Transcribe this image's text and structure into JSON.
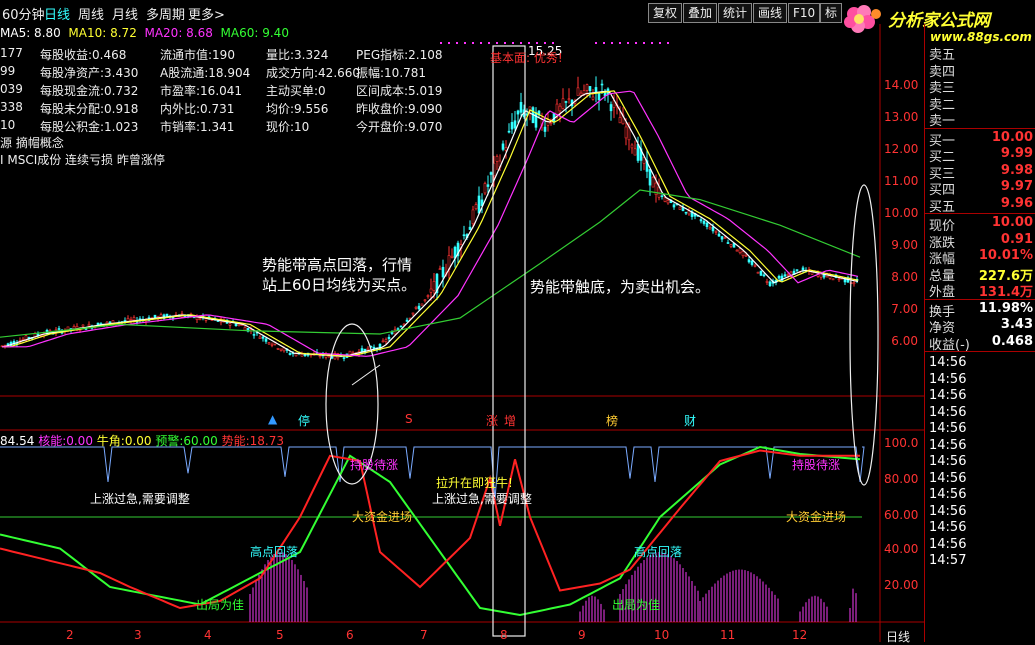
{
  "toolbar": {
    "period_current": "60分钟",
    "day": "日线",
    "week": "周线",
    "month": "月线",
    "multi": "多周期",
    "more": "更多>",
    "buttons": [
      "复权",
      "叠加",
      "统计",
      "画线",
      "F10",
      "标"
    ],
    "logo_text": "分析家公式网",
    "logo_url": "www.88gs.com"
  },
  "info_rows": [
    {
      "c0": "177",
      "c1l": "每股收益:",
      "c1v": "0.468",
      "c2l": "流通市值:",
      "c2v": "190",
      "c3l": "量比:",
      "c3v": "3.324",
      "c4l": "PEG指标:",
      "c4v": "2.108"
    },
    {
      "c0": "99",
      "c1l": "每股净资产:",
      "c1v": "3.430",
      "c2l": "A股流通:",
      "c2v": "18.904",
      "c3l": "成交方向:",
      "c3v": "42.660",
      "c4l": "振幅:",
      "c4v": "10.781"
    },
    {
      "c0": "039",
      "c1l": "每股现金流:",
      "c1v": "0.732",
      "c2l": "市盈率:",
      "c2v": "16.041",
      "c3l": "主动买单:",
      "c3v": "0",
      "c4l": "区间成本:",
      "c4v": "5.019"
    },
    {
      "c0": "338",
      "c1l": "每股未分配:",
      "c1v": "0.918",
      "c2l": "内外比:",
      "c2v": "0.731",
      "c3l": "均价:",
      "c3v": "9.556",
      "c4l": "昨收盘价:",
      "c4v": "9.090"
    },
    {
      "c0": "10",
      "c1l": "每股公积金:",
      "c1v": "1.023",
      "c2l": "市销率:",
      "c2v": "1.341",
      "c3l": "现价:",
      "c3v": "10",
      "c4l": "今开盘价:",
      "c4v": "9.070"
    }
  ],
  "ma_line": {
    "ma5": "MA5: 8.80",
    "ma10": "MA10: 8.72",
    "ma20": "MA20: 8.68",
    "ma60": "MA60: 9.40"
  },
  "concept1": "源 摘帽概念",
  "concept2": "I MSCI成份 连续亏损 昨曾涨停",
  "peak_label": "15.25",
  "peak_note": "基本面: 优秀!",
  "note_left_1": "势能带高点回落，行情",
  "note_left_2": "站上60日均线为买点。",
  "note_right": "势能带触底，为卖出机会。",
  "markers": [
    "停",
    "S",
    "涨",
    "增",
    "榜",
    "财"
  ],
  "price_axis": [
    "14.00",
    "13.00",
    "12.00",
    "11.00",
    "10.00",
    "9.00",
    "8.00",
    "7.00",
    "6.00"
  ],
  "ind_header": {
    "a": "84.54",
    "b_lbl": "核能:",
    "b": "0.00",
    "c_lbl": "牛角:",
    "c": "0.00",
    "d_lbl": "预警:",
    "d": "60.00",
    "e_lbl": "势能:",
    "e": "18.73"
  },
  "ind_axis": [
    "100.0",
    "80.00",
    "60.00",
    "40.00",
    "20.00"
  ],
  "ind_annotations": {
    "hold1": "持股待涨",
    "hold2": "持股待涨",
    "rally": "拉升在即狂牛!",
    "over1": "上涨过急,需要调整",
    "over2": "上涨过急,需要调整",
    "big1": "大资金进场",
    "big2": "大资金进场",
    "high1": "高点回落",
    "high2": "高点回落",
    "exit1": "出局为佳",
    "exit2": "出局为佳"
  },
  "x_ticks": [
    "2",
    "3",
    "4",
    "5",
    "6",
    "7",
    "8",
    "9",
    "10",
    "11",
    "12"
  ],
  "bottom_label": "日线",
  "right_panel": {
    "asks": [
      {
        "l": "卖五",
        "v": ""
      },
      {
        "l": "卖四",
        "v": ""
      },
      {
        "l": "卖三",
        "v": ""
      },
      {
        "l": "卖二",
        "v": ""
      },
      {
        "l": "卖一",
        "v": ""
      }
    ],
    "bids": [
      {
        "l": "买一",
        "v": "10.00"
      },
      {
        "l": "买二",
        "v": "9.99"
      },
      {
        "l": "买三",
        "v": "9.98"
      },
      {
        "l": "买四",
        "v": "9.97"
      },
      {
        "l": "买五",
        "v": "9.96"
      }
    ],
    "stats": [
      {
        "l": "现价",
        "v": "10.00"
      },
      {
        "l": "涨跌",
        "v": "0.91"
      },
      {
        "l": "涨幅",
        "v": "10.01%"
      },
      {
        "l": "总量",
        "v": "227.6万"
      },
      {
        "l": "外盘",
        "v": "131.4万"
      }
    ],
    "stats2": [
      {
        "l": "换手",
        "v": "11.98%"
      },
      {
        "l": "净资",
        "v": "3.43"
      },
      {
        "l": "收益(-)",
        "v": "0.468"
      }
    ],
    "ticks": [
      "14:56",
      "14:56",
      "14:56",
      "14:56",
      "14:56",
      "14:56",
      "14:56",
      "14:56",
      "14:56",
      "14:56",
      "14:56",
      "14:56",
      "14:57"
    ]
  },
  "colors": {
    "up": "#ff3333",
    "down": "#33ffff",
    "ma5": "#ffffff",
    "ma10": "#ffff33",
    "ma20": "#ff33ff",
    "ma60": "#33cc33",
    "grid": "#aa0000"
  }
}
